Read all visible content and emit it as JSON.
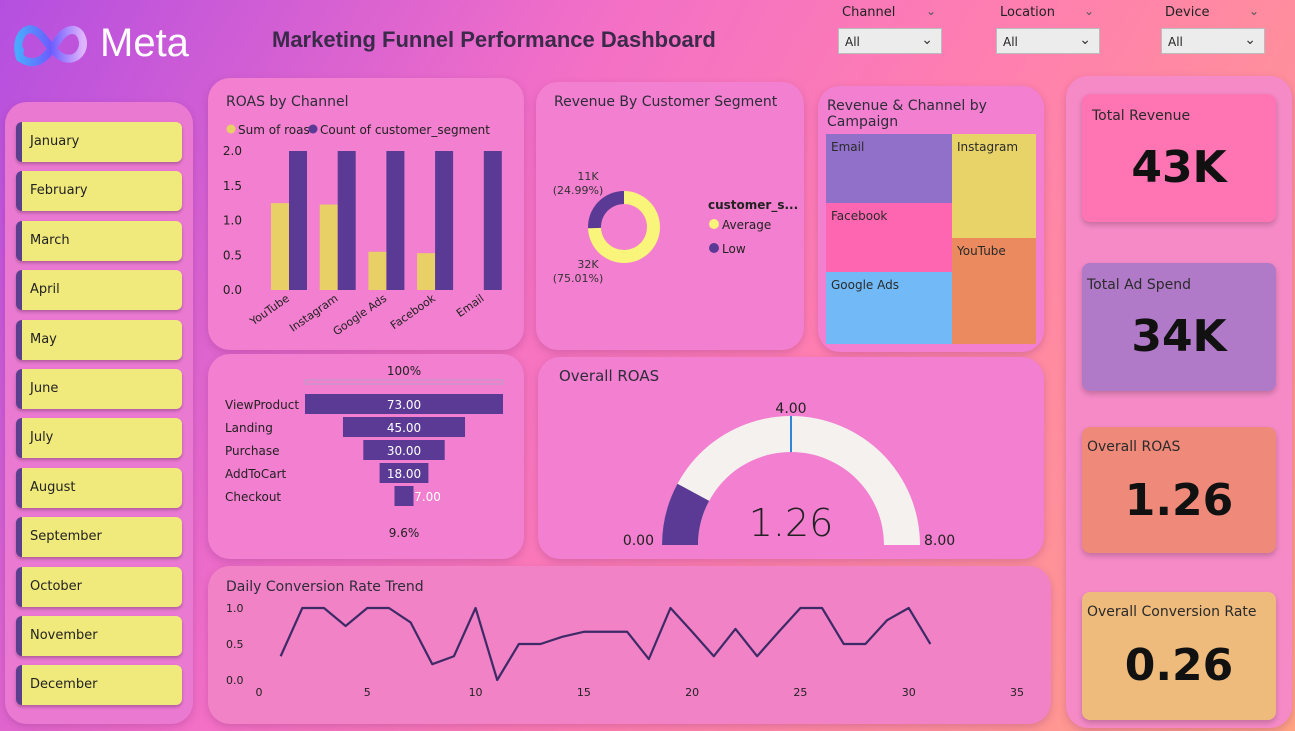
{
  "header": {
    "logo_text": "Meta",
    "title": "Marketing Funnel Performance Dashboard",
    "filters": [
      {
        "label": "Channel",
        "value": "All"
      },
      {
        "label": "Location",
        "value": "All"
      },
      {
        "label": "Device",
        "value": "All"
      }
    ]
  },
  "months": [
    "January",
    "February",
    "March",
    "April",
    "May",
    "June",
    "July",
    "August",
    "September",
    "October",
    "November",
    "December"
  ],
  "kpis": [
    {
      "label": "Total Revenue",
      "value": "43K",
      "color": "#ff74b3"
    },
    {
      "label": "Total Ad Spend",
      "value": "34K",
      "color": "#b07ac9"
    },
    {
      "label": "Overall ROAS",
      "value": "1.26",
      "color": "#ef8a7a"
    },
    {
      "label": "Overall Conversion Rate",
      "value": "0.26",
      "color": "#efbb7c"
    }
  ],
  "colors": {
    "yellow": "#e8cf66",
    "purple": "#5a3a94",
    "donut_yellow": "#f8f57a",
    "gauge_track": "#f4f1ef",
    "gauge_marker": "#2f86d6"
  },
  "chart_data": [
    {
      "type": "bar",
      "title": "ROAS by Channel",
      "categories": [
        "YouTube",
        "Instagram",
        "Google Ads",
        "Facebook",
        "Email"
      ],
      "series": [
        {
          "name": "Sum of roas",
          "values": [
            1.25,
            1.23,
            0.55,
            0.53,
            0
          ]
        },
        {
          "name": "Count of customer_segment",
          "values": [
            2,
            2,
            2,
            2,
            2
          ]
        }
      ],
      "yticks": [
        "0.0",
        "0.5",
        "1.0",
        "1.5",
        "2.0"
      ],
      "ylim": [
        0,
        2
      ]
    },
    {
      "type": "pie",
      "title": "Revenue By Customer Segment",
      "legend_title": "customer_s...",
      "slices": [
        {
          "name": "Average",
          "value": 32,
          "label": "32K",
          "pct": "(75.01%)"
        },
        {
          "name": "Low",
          "value": 11,
          "label": "11K",
          "pct": "(24.99%)"
        }
      ]
    },
    {
      "type": "treemap",
      "title": "Revenue & Channel by Campaign",
      "cells": [
        {
          "name": "Email",
          "color": "#9170c9"
        },
        {
          "name": "Instagram",
          "color": "#e8d368"
        },
        {
          "name": "Facebook",
          "color": "#ff66b2"
        },
        {
          "name": "YouTube",
          "color": "#ea8a5e"
        },
        {
          "name": "Google Ads",
          "color": "#71baf7"
        }
      ]
    },
    {
      "type": "funnel",
      "top_label": "100%",
      "bottom_label": "9.6%",
      "categories": [
        "ViewProduct",
        "Landing",
        "Purchase",
        "AddToCart",
        "Checkout"
      ],
      "values": [
        73,
        45,
        30,
        18,
        7
      ],
      "value_labels": [
        "73.00",
        "45.00",
        "30.00",
        "18.00",
        "7.00"
      ]
    },
    {
      "type": "gauge",
      "title": "Overall ROAS",
      "value": 1.26,
      "value_label": "1.26",
      "min": 0,
      "max": 8,
      "target": 4,
      "min_label": "0.00",
      "max_label": "8.00",
      "target_label": "4.00"
    },
    {
      "type": "line",
      "title": "Daily Conversion Rate Trend",
      "x": [
        1,
        2,
        3,
        4,
        5,
        6,
        7,
        8,
        9,
        10,
        11,
        12,
        13,
        14,
        15,
        16,
        17,
        18,
        19,
        20,
        21,
        22,
        23,
        24,
        25,
        26,
        27,
        28,
        29,
        30,
        31
      ],
      "y": [
        0.33,
        1.0,
        1.0,
        0.75,
        1.0,
        1.0,
        0.8,
        0.22,
        0.33,
        1.0,
        0.0,
        0.5,
        0.5,
        0.6,
        0.67,
        0.67,
        0.67,
        0.29,
        1.0,
        0.67,
        0.33,
        0.71,
        0.33,
        0.67,
        1.0,
        1.0,
        0.5,
        0.5,
        0.83,
        1.0,
        0.5
      ],
      "xticks": [
        "0",
        "5",
        "10",
        "15",
        "20",
        "25",
        "30",
        "35"
      ],
      "xlim": [
        0,
        35
      ],
      "yticks": [
        "0.0",
        "0.5",
        "1.0"
      ],
      "ylim": [
        0,
        1
      ]
    }
  ]
}
